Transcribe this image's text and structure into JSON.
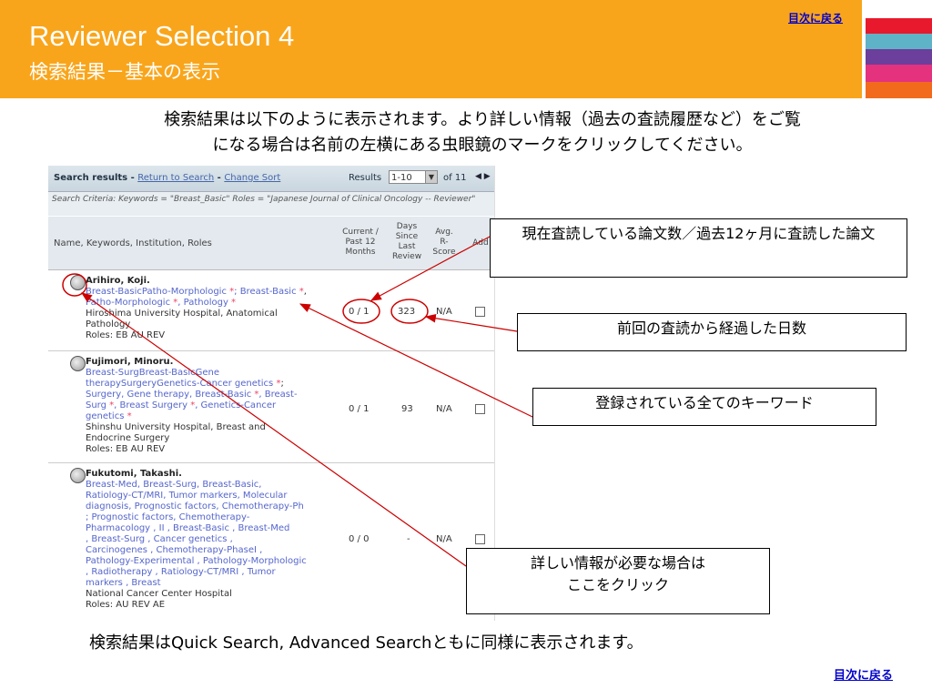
{
  "header": {
    "title": "Reviewer Selection 4",
    "subtitle": "検索結果－基本の表示",
    "toc_link": "目次に戻る"
  },
  "colors": {
    "header_bg": "#f9a51b",
    "stripes": [
      "#e8192c",
      "#5fb3c6",
      "#6b3f9b",
      "#e4327f",
      "#f26b1d"
    ],
    "annotation": "#cc0000"
  },
  "intro": {
    "line1": "検索結果は以下のように表示されます。より詳しい情報（過去の査読履歴など）をご覧",
    "line2": "になる場合は名前の左横にある虫眼鏡のマークをクリックしてください。"
  },
  "screenshot": {
    "bar_title": "Search results",
    "sep1": " - ",
    "return_link": "Return to Search",
    "sep2": " - ",
    "change_sort_link": "Change Sort",
    "results_label": "Results",
    "results_select": "1-10",
    "of_label": "of 11",
    "criteria": "Search Criteria: Keywords = \"Breast_Basic\" Roles = \"Japanese Journal of Clinical Oncology -- Reviewer\"",
    "columns": {
      "name": "Name, Keywords, Institution, Roles",
      "current": [
        "Current /",
        "Past 12",
        "Months"
      ],
      "days": [
        "Days",
        "Since",
        "Last",
        "Review"
      ],
      "avg": [
        "Avg.",
        "R-",
        "Score"
      ],
      "add": "Add"
    },
    "rows": [
      {
        "name": "Arihiro, Koji.",
        "kw1": "Breast-BasicPatho-Morphologic ",
        "kw1b": "; Breast-Basic ",
        "kw2": "Patho-Morphologic ",
        "kw2b": ", Pathology ",
        "institution": "Hiroshima University Hospital, Anatomical",
        "institution2": "Pathology",
        "roles": "Roles: EB AU REV",
        "current": "0 / 1",
        "days": "323",
        "avg": "N/A"
      },
      {
        "name": "Fujimori, Minoru.",
        "kw1": "Breast-SurgBreast-BasicGene",
        "kw2": "therapySurgeryGenetics-Cancer genetics ",
        "kw3": "Surgery, Gene therapy, Breast-Basic ",
        "kw3b": ", Breast-",
        "kw4": "Surg ",
        "kw4b": ", Breast Surgery ",
        "kw4c": ", Genetics-Cancer",
        "kw5": "genetics ",
        "institution": "Shinshu University Hospital, Breast and",
        "institution2": "Endocrine Surgery",
        "roles": "Roles: EB AU REV",
        "current": "0 / 1",
        "days": "93",
        "avg": "N/A"
      },
      {
        "name": "Fukutomi, Takashi.",
        "kw_lines": [
          "Breast-Med, Breast-Surg, Breast-Basic,",
          "Ratiology-CT/MRI, Tumor markers, Molecular",
          "diagnosis, Prognostic factors, Chemotherapy-Ph",
          "; Prognostic factors, Chemotherapy-",
          "Pharmacology , II , Breast-Basic , Breast-Med",
          ", Breast-Surg , Cancer genetics ,",
          "Carcinogenes , Chemotherapy-PhaseI ,",
          "Pathology-Experimental , Pathology-Morphologic",
          ", Radiotherapy , Ratiology-CT/MRI , Tumor",
          "markers , Breast"
        ],
        "institution": "National Cancer Center Hospital",
        "roles": "Roles: AU REV AE",
        "current": "0 / 0",
        "days": "-",
        "avg": "N/A"
      }
    ]
  },
  "callouts": {
    "reviews": "現在査読している論文数／過去12ヶ月に査読した論文",
    "days": "前回の査読から経過した日数",
    "keywords": "登録されている全てのキーワード",
    "details": "詳しい情報が必要な場合は\nここをクリック"
  },
  "footer": {
    "note": "検索結果はQuick Search, Advanced Searchともに同様に表示されます。",
    "toc_link": "目次に戻る"
  }
}
